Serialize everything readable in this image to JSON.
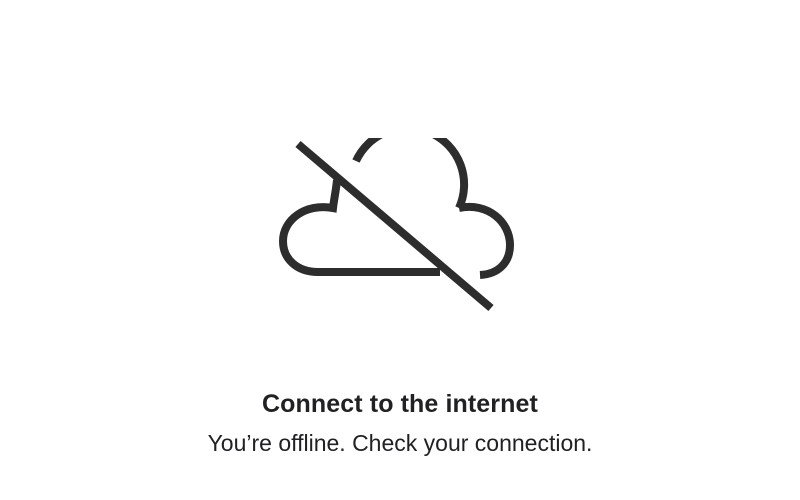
{
  "offline": {
    "icon": "cloud-off-icon",
    "title": "Connect to the internet",
    "message": "You’re offline. Check your connection."
  },
  "colors": {
    "background": "#ffffff",
    "icon": "#2d2d2d",
    "text": "#202124"
  }
}
